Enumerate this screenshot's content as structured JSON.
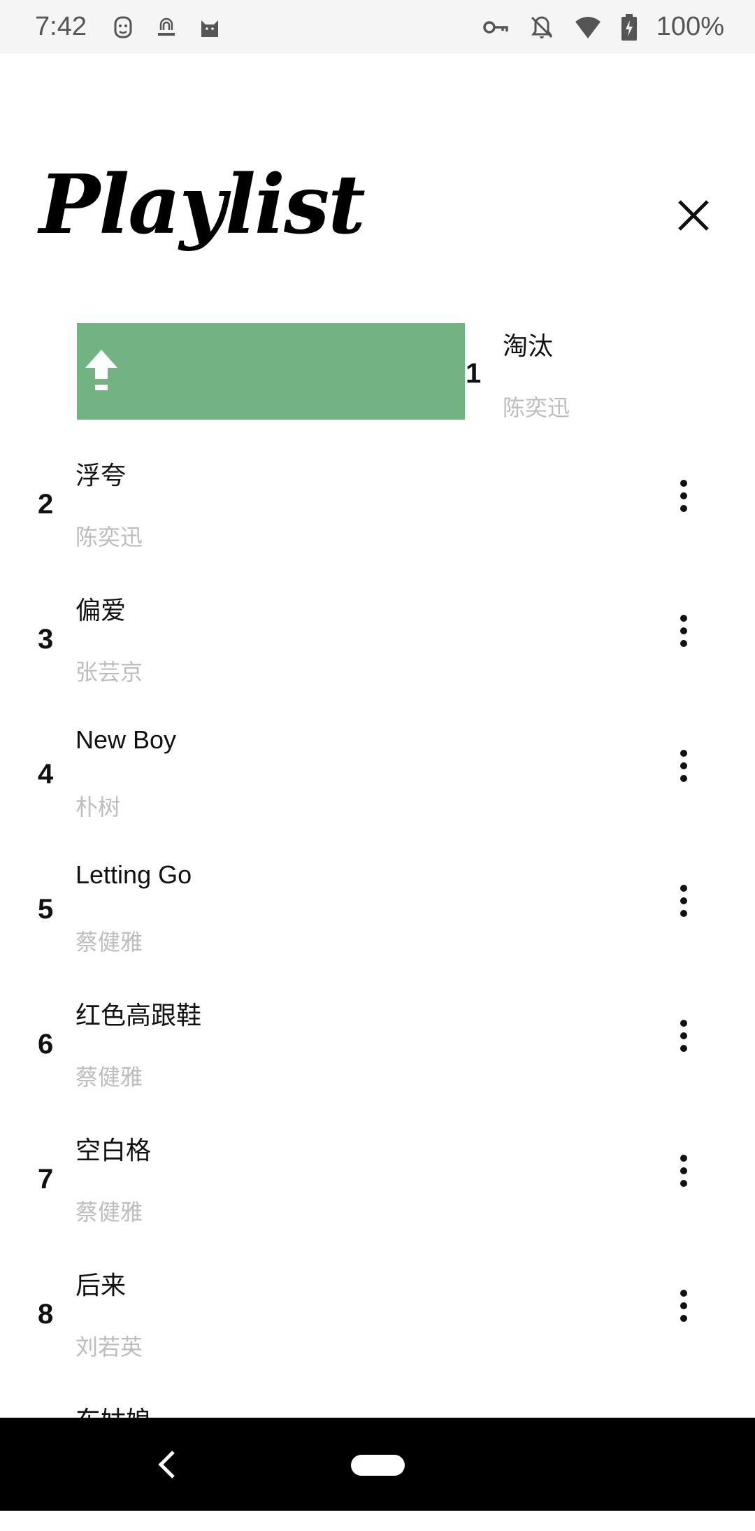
{
  "status_bar": {
    "time": "7:42",
    "left_icons": [
      "face-icon",
      "fingerprint-badge-icon",
      "cat-icon"
    ],
    "right_icons": [
      "key-icon",
      "notifications-off-icon",
      "wifi-icon",
      "battery-charging-icon"
    ],
    "battery": "100%"
  },
  "header": {
    "title": "Playlist",
    "close_icon": "close-icon"
  },
  "swiped_item": {
    "number": "1",
    "title": "淘汰",
    "artist": "陈奕迅",
    "action_icon": "move-to-top-icon",
    "action_color": "#73b383"
  },
  "playlist": [
    {
      "number": "2",
      "title": "浮夸",
      "artist": "陈奕迅"
    },
    {
      "number": "3",
      "title": "偏爱",
      "artist": "张芸京"
    },
    {
      "number": "4",
      "title": "New Boy",
      "artist": "朴树"
    },
    {
      "number": "5",
      "title": "Letting Go",
      "artist": "蔡健雅"
    },
    {
      "number": "6",
      "title": "红色高跟鞋",
      "artist": "蔡健雅"
    },
    {
      "number": "7",
      "title": "空白格",
      "artist": "蔡健雅"
    },
    {
      "number": "8",
      "title": "后来",
      "artist": "刘若英"
    },
    {
      "number": "",
      "title": "东姑娘",
      "artist": ""
    }
  ],
  "nav_bar": {
    "back_icon": "back-icon",
    "home_icon": "home-pill-icon"
  }
}
